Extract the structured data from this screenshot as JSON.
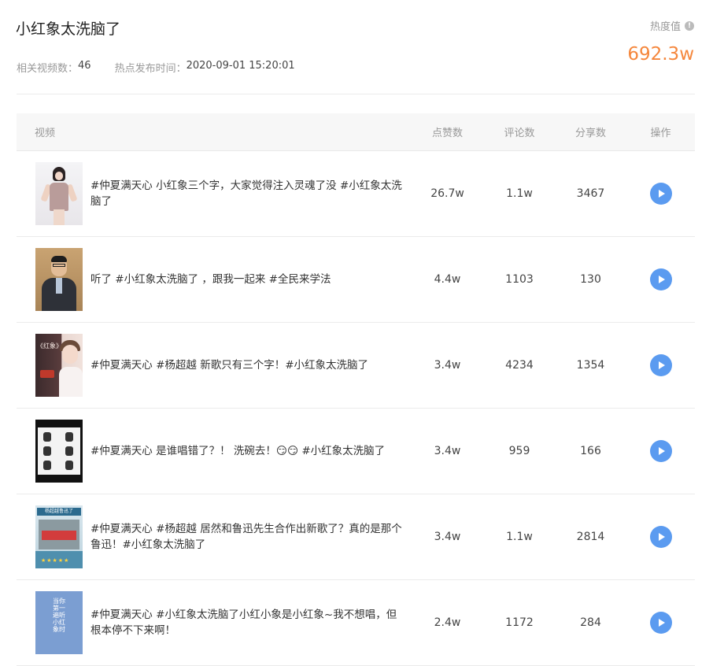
{
  "header": {
    "title": "小红象太洗脑了",
    "video_count_label": "相关视频数：",
    "video_count": "46",
    "publish_label": "热点发布时间：",
    "publish_time": "2020-09-01 15:20:01",
    "heat_label": "热度值",
    "heat_value": "692.3w"
  },
  "table": {
    "columns": {
      "video": "视频",
      "likes": "点赞数",
      "comments": "评论数",
      "shares": "分享数",
      "action": "操作"
    },
    "rows": [
      {
        "desc": "#仲夏满天心 小红象三个字，大家觉得注入灵魂了没 #小红象太洗脑了",
        "likes": "26.7w",
        "comments": "1.1w",
        "shares": "3467"
      },
      {
        "desc": "听了 #小红象太洗脑了 ，跟我一起来 #全民来学法",
        "likes": "4.4w",
        "comments": "1103",
        "shares": "130"
      },
      {
        "desc": "#仲夏满天心 #杨超越 新歌只有三个字！#小红象太洗脑了",
        "likes": "3.4w",
        "comments": "4234",
        "shares": "1354"
      },
      {
        "desc": "#仲夏满天心 是谁唱错了？！ 洗碗去！😏😏 #小红象太洗脑了",
        "likes": "3.4w",
        "comments": "959",
        "shares": "166"
      },
      {
        "desc": "#仲夏满天心 #杨超越 居然和鲁迅先生合作出新歌了？真的是那个鲁迅！#小红象太洗脑了",
        "likes": "3.4w",
        "comments": "1.1w",
        "shares": "2814"
      },
      {
        "desc": "#仲夏满天心 #小红象太洗脑了小红小象是小红象~我不想唱，但根本停不下来啊！",
        "likes": "2.4w",
        "comments": "1172",
        "shares": "284"
      }
    ]
  },
  "thumbnails": {
    "t3_text": "《红象》",
    "t5_banner": "杨超越鲁迅了",
    "t6_text": "当你第一遍听小红象时"
  },
  "colors": {
    "heat": "#f5873d",
    "play": "#5b9bf0"
  },
  "icons": {
    "info": "info-icon",
    "play": "play-icon"
  }
}
